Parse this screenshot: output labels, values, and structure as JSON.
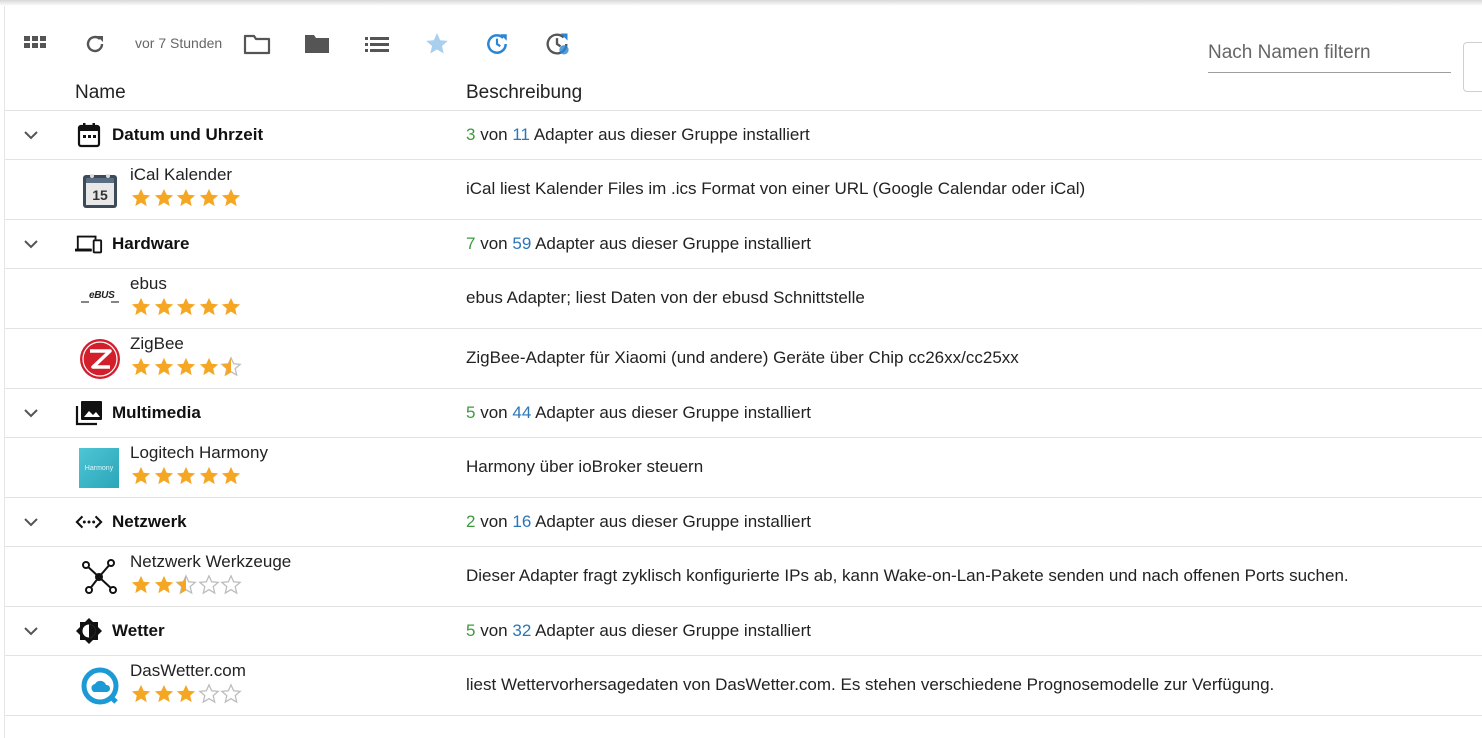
{
  "toolbar": {
    "updated_text": "vor 7 Stunden",
    "filter_placeholder": "Nach Namen filtern",
    "icons": [
      "grid-icon",
      "refresh-icon",
      "folder-outline-icon",
      "folder-icon",
      "list-icon",
      "star-icon",
      "update-icon",
      "update-history-icon"
    ]
  },
  "table": {
    "col_name": "Name",
    "col_desc": "Beschreibung"
  },
  "groups": [
    {
      "title": "Datum und Uhrzeit",
      "icon": "calendar-icon",
      "installed": "3",
      "von": "von",
      "total": "11",
      "suffix": "Adapter aus dieser Gruppe installiert",
      "items": [
        {
          "name": "iCal Kalender",
          "rating": 5,
          "icon": "ical-calendar-logo",
          "desc": "iCal liest Kalender Files im .ics Format von einer URL (Google Calendar oder iCal)"
        }
      ]
    },
    {
      "title": "Hardware",
      "icon": "devices-icon",
      "installed": "7",
      "von": "von",
      "total": "59",
      "suffix": "Adapter aus dieser Gruppe installiert",
      "items": [
        {
          "name": "ebus",
          "rating": 5,
          "icon": "ebus-logo",
          "logo_text": "eBUS",
          "desc": "ebus Adapter; liest Daten von der ebusd Schnittstelle"
        },
        {
          "name": "ZigBee",
          "rating": 4.5,
          "icon": "zigbee-logo",
          "desc": "ZigBee-Adapter für Xiaomi (und andere) Geräte über Chip cc26xx/cc25xx"
        }
      ]
    },
    {
      "title": "Multimedia",
      "icon": "photo-library-icon",
      "installed": "5",
      "von": "von",
      "total": "44",
      "suffix": "Adapter aus dieser Gruppe installiert",
      "items": [
        {
          "name": "Logitech Harmony",
          "rating": 5,
          "icon": "harmony-logo",
          "logo_text": "Harmony",
          "desc": "Harmony über ioBroker steuern"
        }
      ]
    },
    {
      "title": "Netzwerk",
      "icon": "network-code-icon",
      "installed": "2",
      "von": "von",
      "total": "16",
      "suffix": "Adapter aus dieser Gruppe installiert",
      "items": [
        {
          "name": "Netzwerk Werkzeuge",
          "rating": 2.5,
          "icon": "network-tools-logo",
          "desc": "Dieser Adapter fragt zyklisch konfigurierte IPs ab, kann Wake-on-Lan-Pakete senden und nach offenen Ports suchen."
        }
      ]
    },
    {
      "title": "Wetter",
      "icon": "brightness-icon",
      "installed": "5",
      "von": "von",
      "total": "32",
      "suffix": "Adapter aus dieser Gruppe installiert",
      "items": [
        {
          "name": "DasWetter.com",
          "rating": 3,
          "icon": "daswetter-logo",
          "desc": "liest Wettervorhersagedaten von DasWetter.com. Es stehen verschiedene Prognosemodelle zur Verfügung."
        }
      ]
    }
  ],
  "colors": {
    "installed": "#3e9a3e",
    "total": "#2b76b9",
    "star": "#f5a623",
    "star_empty": "#bdbdbd",
    "toolbar_icon": "#555555",
    "accent_blue": "#2b86d3"
  }
}
